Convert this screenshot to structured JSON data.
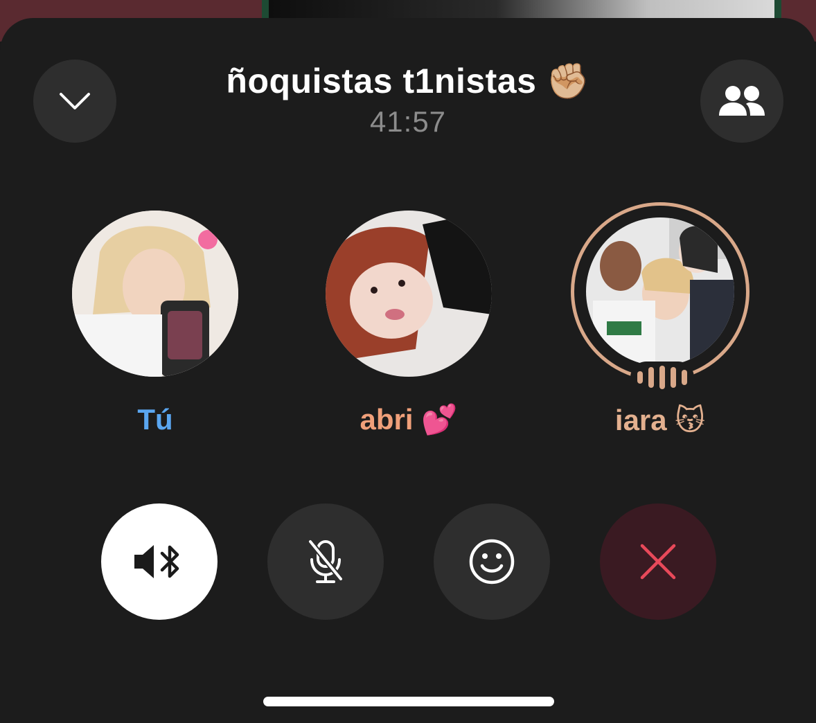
{
  "header": {
    "title": "ñoquistas t1nistas ✊🏼",
    "timer": "41:57"
  },
  "participants": [
    {
      "name": "Tú",
      "color": "#5aa6f0",
      "speaking": false
    },
    {
      "name": "abri 💕",
      "color": "#f0a07a",
      "speaking": false
    },
    {
      "name": "iara 😽",
      "color": "#e3b08f",
      "speaking": true
    }
  ],
  "icons": {
    "collapse": "chevron-down-icon",
    "participants": "people-icon",
    "speaker": "speaker-bluetooth-icon",
    "mute": "microphone-muted-icon",
    "emoji": "smiley-icon",
    "end": "close-icon"
  },
  "colors": {
    "background": "#1c1c1c",
    "button": "#2e2e2e",
    "end_call": "#e8495a",
    "speaking_ring": "#d9a889"
  }
}
